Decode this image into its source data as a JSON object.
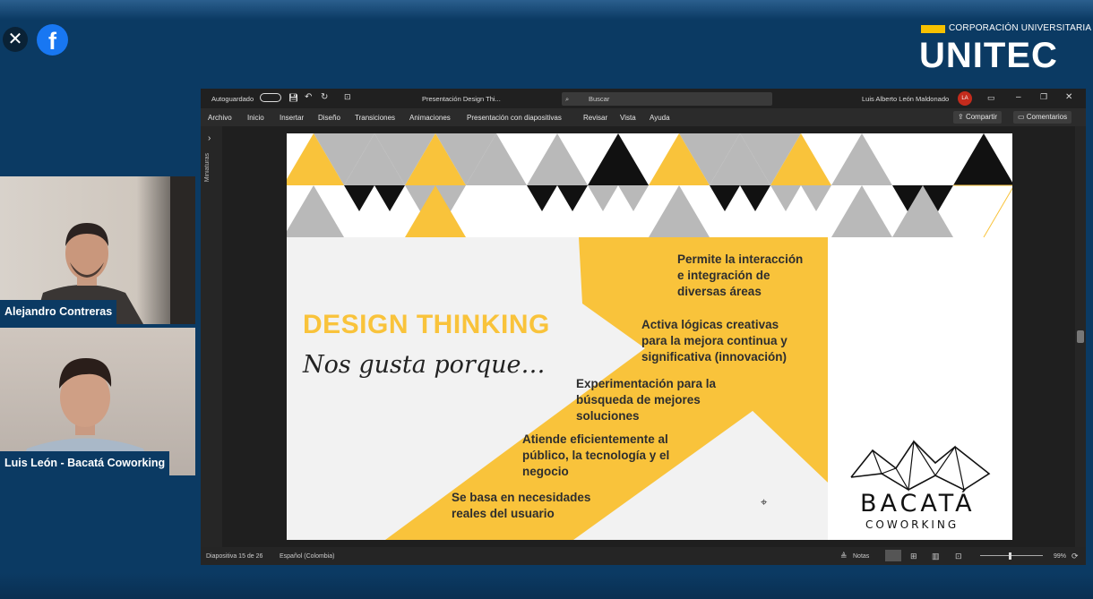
{
  "overlay": {
    "close_icon": "close-icon",
    "facebook_icon": "facebook-icon"
  },
  "logo": {
    "subtitle": "CORPORACIÓN UNIVERSITARIA",
    "name": "UNITEC",
    "accent": "#f7c100"
  },
  "participants": [
    {
      "name": "Alejandro Contreras"
    },
    {
      "name": "Luis León - Bacatá Coworking"
    }
  ],
  "powerpoint": {
    "autosave_label": "Autoguardado",
    "doc_title": "Presentación Design Thi...",
    "search_placeholder": "Buscar",
    "user_name": "Luis Alberto León Maldonado",
    "user_initials": "LA",
    "menu": [
      "Archivo",
      "Inicio",
      "Insertar",
      "Diseño",
      "Transiciones",
      "Animaciones",
      "Presentación con diapositivas",
      "Revisar",
      "Vista",
      "Ayuda"
    ],
    "share_label": "Compartir",
    "comments_label": "Comentarios",
    "thumbnails_label": "Miniaturas",
    "status": {
      "slide_counter": "Diapositiva 15 de 26",
      "language": "Español (Colombia)",
      "notes_label": "Notas",
      "zoom": "99%"
    }
  },
  "slide": {
    "title": "DESIGN THINKING",
    "subtitle": "Nos gusta porque…",
    "bullets": [
      "Permite la interacción\ne integración de\ndiversas áreas",
      "Activa lógicas creativas\npara la mejora continua y\nsignificativa (innovación)",
      "Experimentación para la\nbúsqueda de mejores\nsoluciones",
      "Atiende eficientemente al\npúblico, la tecnología y el\nnegocio",
      "Se basa en necesidades\nreales del usuario"
    ],
    "brand_name": "BACATÁ",
    "brand_sub": "COWORKING",
    "accent": "#f9c33b"
  }
}
